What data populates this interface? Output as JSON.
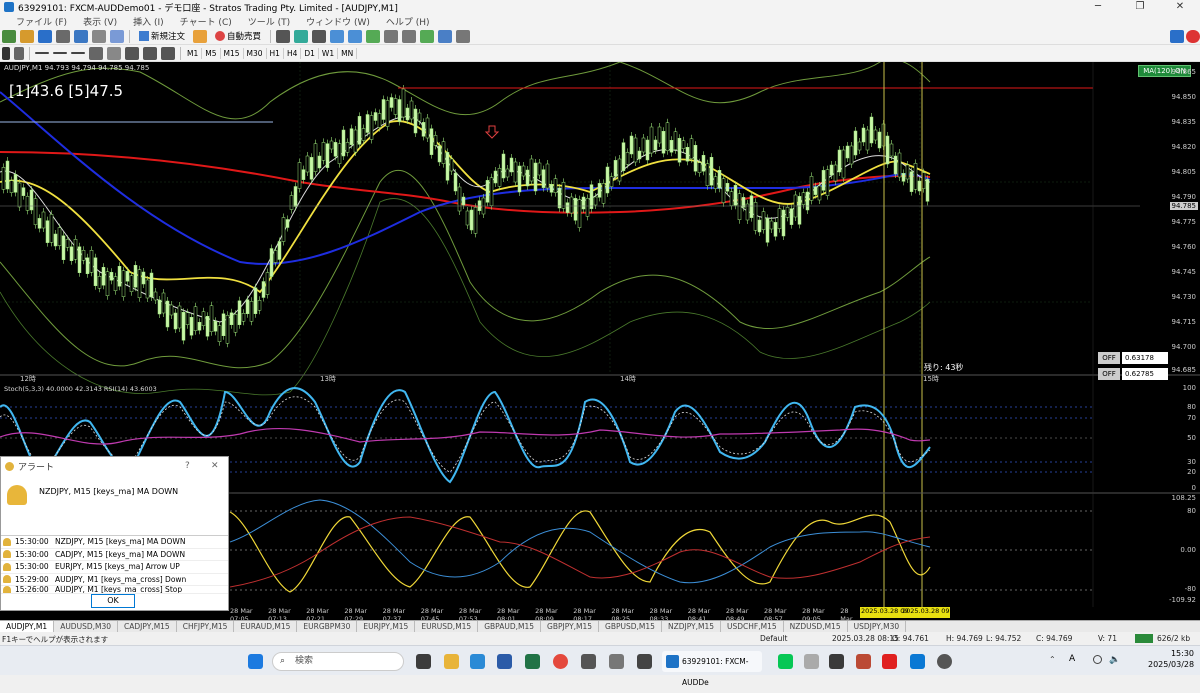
{
  "window": {
    "title": "63929101: FXCM-AUDDemo01 - デモ口座 - Stratos Trading Pty. Limited - [AUDJPY,M1]"
  },
  "menu": [
    "ファイル (F)",
    "表示 (V)",
    "挿入 (I)",
    "チャート (C)",
    "ツール (T)",
    "ウィンドウ (W)",
    "ヘルプ (H)"
  ],
  "toolbar": {
    "new_order": "新規注文",
    "auto_trade": "自動売買",
    "timeframes": [
      "M1",
      "M5",
      "M15",
      "M30",
      "H1",
      "H4",
      "D1",
      "W1",
      "MN"
    ]
  },
  "chart": {
    "header": "AUDJPY,M1  94.793 94.794 94.785 94.785",
    "overlay_text": "[1]43.6 [5]47.5",
    "ma_badge": "MA(120) ON",
    "price_labels": [
      "94.865",
      "94.850",
      "94.835",
      "94.820",
      "94.805",
      "94.790",
      "94.775",
      "94.760",
      "94.745",
      "94.730",
      "94.715",
      "94.700",
      "94.685"
    ],
    "current_price": "94.785",
    "remaining": "残り: 43秒",
    "off_rows": [
      {
        "label": "OFF",
        "value": "0.63178"
      },
      {
        "label": "OFF",
        "value": "0.62785"
      }
    ],
    "hour_labels": [
      "12時",
      "13時",
      "14時",
      "15時"
    ],
    "stoch_header": "Stoch(5,3,3) 40.0000 42.3143  RSI(14) 43.6003",
    "stoch_levels": [
      "100",
      "80",
      "70",
      "50",
      "30",
      "20",
      "0"
    ],
    "osc_levels": [
      "108.25",
      "80",
      "0.00",
      "-80",
      "-109.92"
    ],
    "time_labels": [
      "28 Mar 07:05",
      "28 Mar 07:13",
      "28 Mar 07:21",
      "28 Mar 07:29",
      "28 Mar 07:37",
      "28 Mar 07:45",
      "28 Mar 07:53",
      "28 Mar 08:01",
      "28 Mar 08:09",
      "28 Mar 08:17",
      "28 Mar 08:25",
      "28 Mar 08:33",
      "28 Mar 08:41",
      "28 Mar 08:49",
      "28 Mar 08:57",
      "28 Mar 09:05",
      "28 Mar"
    ],
    "cursor_labels": [
      "2025.03.28 09",
      "2025.03.28 09:29"
    ]
  },
  "alert": {
    "title": "アラート",
    "message": "NZDJPY, M15 [keys_ma] MA DOWN",
    "rows": [
      {
        "time": "15:30:00",
        "text": "NZDJPY, M15 [keys_ma] MA DOWN"
      },
      {
        "time": "15:30:00",
        "text": "CADJPY, M15 [keys_ma] MA DOWN"
      },
      {
        "time": "15:30:00",
        "text": "EURJPY, M15 [keys_ma] Arrow UP"
      },
      {
        "time": "15:29:00",
        "text": "AUDJPY, M1 [keys_ma_cross] Down"
      },
      {
        "time": "15:26:00",
        "text": "AUDJPY, M1 [keys_ma_cross] Stop"
      }
    ],
    "ok": "OK"
  },
  "tabs": [
    "AUDJPY,M1",
    "AUDUSD,M30",
    "CADJPY,M15",
    "CHFJPY,M15",
    "EURAUD,M15",
    "EURGBPM30",
    "EURJPY,M15",
    "EURUSD,M15",
    "GBPAUD,M15",
    "GBPJPY,M15",
    "GBPUSD,M15",
    "NZDJPY,M15",
    "USDCHF,M15",
    "NZDUSD,M15",
    "USDJPY,M30"
  ],
  "status": {
    "help": "F1キーでヘルプが表示されます",
    "profile": "Default",
    "datetime": "2025.03.28 08:15",
    "open": "O: 94.761",
    "high": "H: 94.769",
    "low": "L: 94.752",
    "close": "C: 94.769",
    "volume": "V: 71",
    "traffic": "626/2 kb"
  },
  "taskbar": {
    "search": "検索",
    "app_label": "63929101: FXCM-AUDDe",
    "ime": "A",
    "time": "15:30",
    "date": "2025/03/28"
  }
}
